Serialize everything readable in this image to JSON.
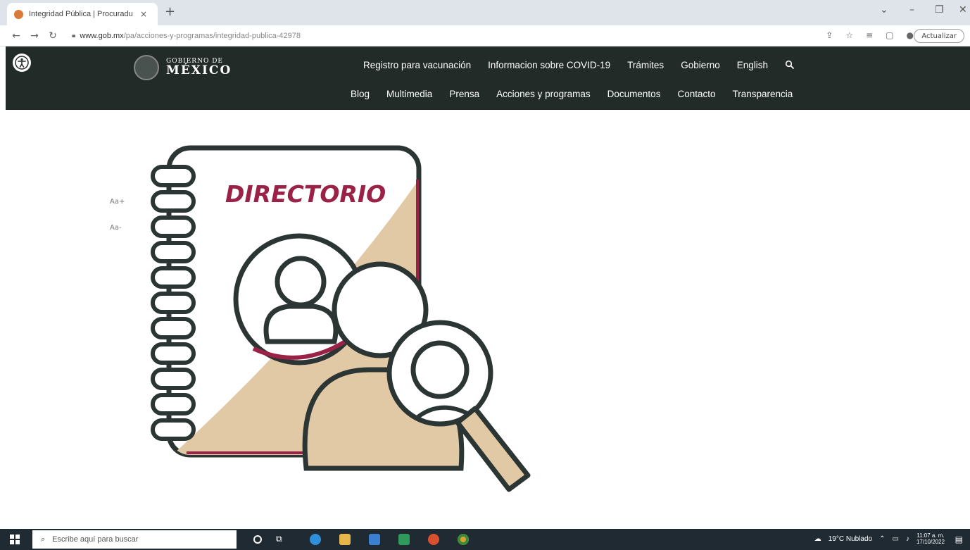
{
  "browser": {
    "tab_title": "Integridad Pública | Procuradu",
    "tab_close": "×",
    "new_tab": "+",
    "url_host": "www.gob.mx",
    "url_path": "/pa/acciones-y-programas/integridad-publica-42978",
    "update_label": "Actualizar"
  },
  "site": {
    "logo_line1": "GOBIERNO DE",
    "logo_line2": "MÉXICO",
    "nav_row1": [
      "Registro para vacunación",
      "Informacion sobre COVID-19",
      "Trámites",
      "Gobierno",
      "English"
    ],
    "nav_row2": [
      "Blog",
      "Multimedia",
      "Prensa",
      "Acciones y programas",
      "Documentos",
      "Contacto",
      "Transparencia"
    ]
  },
  "font_controls": {
    "increase": "Aa+",
    "decrease": "Aa-"
  },
  "illustration": {
    "title": "DIRECTORIO"
  },
  "taskbar": {
    "search_placeholder": "Escribe aquí para buscar",
    "weather": "19°C Nublado",
    "time": "11:07 a. m.",
    "date": "17/10/2022"
  },
  "colors": {
    "nav_bg": "#232b29",
    "accent": "#9b2247",
    "beige": "#e2c9a6",
    "outline": "#2b3533"
  }
}
